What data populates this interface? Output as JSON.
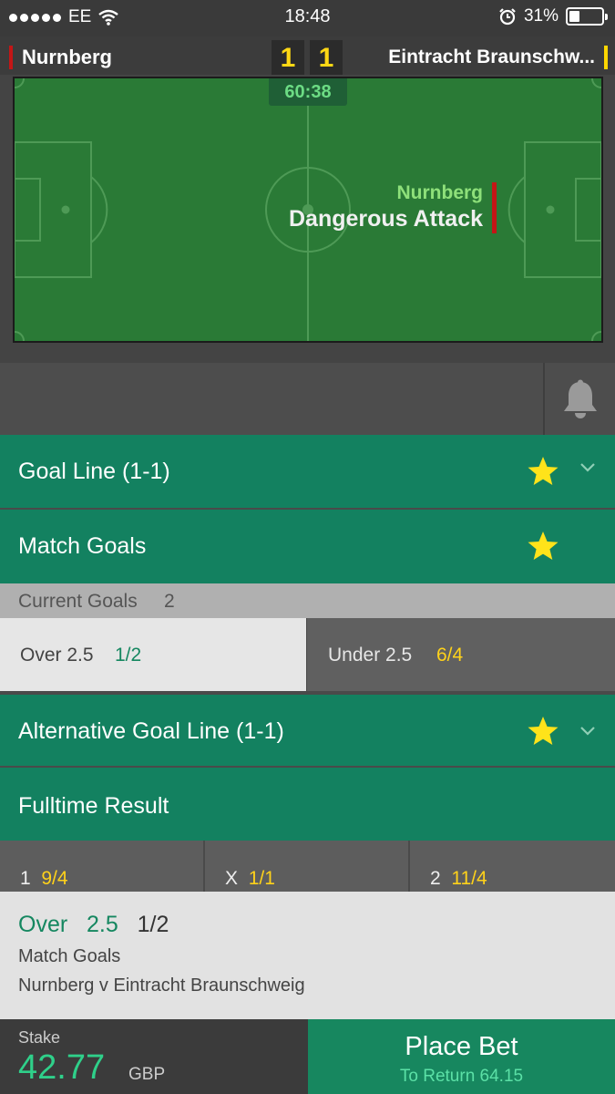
{
  "status_bar": {
    "carrier": "EE",
    "time": "18:48",
    "battery_percent": "31%",
    "battery_level": 0.31
  },
  "match": {
    "home_team": "Nurnberg",
    "away_team": "Eintracht Braunschw...",
    "home_score": "1",
    "away_score": "1",
    "clock": "60:38",
    "event_team": "Nurnberg",
    "event_text": "Dangerous Attack"
  },
  "markets": {
    "goal_line": "Goal Line (1-1)",
    "match_goals": "Match Goals",
    "current_goals_label": "Current Goals",
    "current_goals_value": "2",
    "over_label": "Over 2.5",
    "over_odds": "1/2",
    "under_label": "Under 2.5",
    "under_odds": "6/4",
    "alt_goal_line": "Alternative Goal Line (1-1)",
    "fulltime_result": "Fulltime Result",
    "ft_home_label": "1",
    "ft_home_odds": "9/4",
    "ft_draw_label": "X",
    "ft_draw_odds": "1/1",
    "ft_away_label": "2",
    "ft_away_odds": "11/4"
  },
  "betslip": {
    "selection": "Over",
    "line": "2.5",
    "odds": "1/2",
    "market": "Match Goals",
    "event": "Nurnberg v Eintracht Braunschweig",
    "stake_label": "Stake",
    "stake_value": "42.77",
    "currency": "GBP",
    "place_bet_label": "Place Bet",
    "to_return": "To Return 64.15"
  },
  "colors": {
    "market_green": "#138160",
    "pitch_green": "#2a7a36",
    "score_yellow": "#ffd814",
    "star_yellow": "#ffe31a",
    "home_red": "#c41616"
  },
  "icons": [
    "signal-dots-icon",
    "wifi-icon",
    "alarm-icon",
    "battery-icon",
    "bell-icon",
    "star-icon",
    "chevron-down-icon"
  ]
}
